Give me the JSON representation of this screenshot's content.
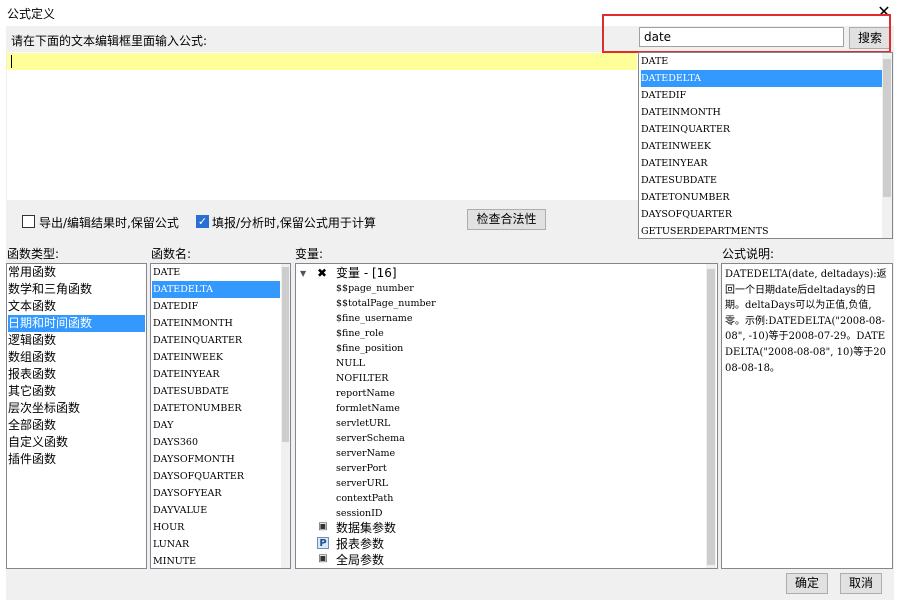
{
  "window": {
    "title": "公式定义",
    "close_label": "✕"
  },
  "editor": {
    "instruction": "请在下面的文本编辑框里面输入公式:"
  },
  "search": {
    "value": "date",
    "button_label": "搜索"
  },
  "search_results": [
    "DATE",
    "DATEDELTA",
    "DATEDIF",
    "DATEINMONTH",
    "DATEINQUARTER",
    "DATEINWEEK",
    "DATEINYEAR",
    "DATESUBDATE",
    "DATETONUMBER",
    "DAYSOFQUARTER",
    "GETUSERDEPARTMENTS"
  ],
  "search_selected_index": 1,
  "options": {
    "keep_on_export_label": "导出/编辑结果时,保留公式",
    "keep_on_export_checked": false,
    "keep_on_fill_label": "填报/分析时,保留公式用于计算",
    "keep_on_fill_checked": true,
    "validate_button": "检查合法性"
  },
  "func_types": {
    "header": "函数类型:",
    "items": [
      "常用函数",
      "数学和三角函数",
      "文本函数",
      "日期和时间函数",
      "逻辑函数",
      "数组函数",
      "报表函数",
      "其它函数",
      "层次坐标函数",
      "全部函数",
      "自定义函数",
      "插件函数"
    ],
    "selected_index": 3
  },
  "func_names": {
    "header": "函数名:",
    "items": [
      "DATE",
      "DATEDELTA",
      "DATEDIF",
      "DATEINMONTH",
      "DATEINQUARTER",
      "DATEINWEEK",
      "DATEINYEAR",
      "DATESUBDATE",
      "DATETONUMBER",
      "DAY",
      "DAYS360",
      "DAYSOFMONTH",
      "DAYSOFQUARTER",
      "DAYSOFYEAR",
      "DAYVALUE",
      "HOUR",
      "LUNAR",
      "MINUTE"
    ],
    "selected_index": 1
  },
  "variables": {
    "header": "变量:",
    "root_label": "变量 - [16]",
    "items": [
      "$$page_number",
      "$$totalPage_number",
      "$fine_username",
      "$fine_role",
      "$fine_position",
      "NULL",
      "NOFILTER",
      "reportName",
      "formletName",
      "servletURL",
      "serverSchema",
      "serverName",
      "serverPort",
      "serverURL",
      "contextPath",
      "sessionID"
    ],
    "groups": [
      "数据集参数",
      "报表参数",
      "全局参数"
    ]
  },
  "description": {
    "header": "公式说明:",
    "text": "DATEDELTA(date, deltadays):返回一个日期date后deltadays的日期。deltaDays可以为正值,负值,零。示例:DATEDELTA(\"2008-08-08\", -10)等于2008-07-29。DATEDELTA(\"2008-08-08\", 10)等于2008-08-18。"
  },
  "footer": {
    "ok_label": "确定",
    "cancel_label": "取消"
  }
}
